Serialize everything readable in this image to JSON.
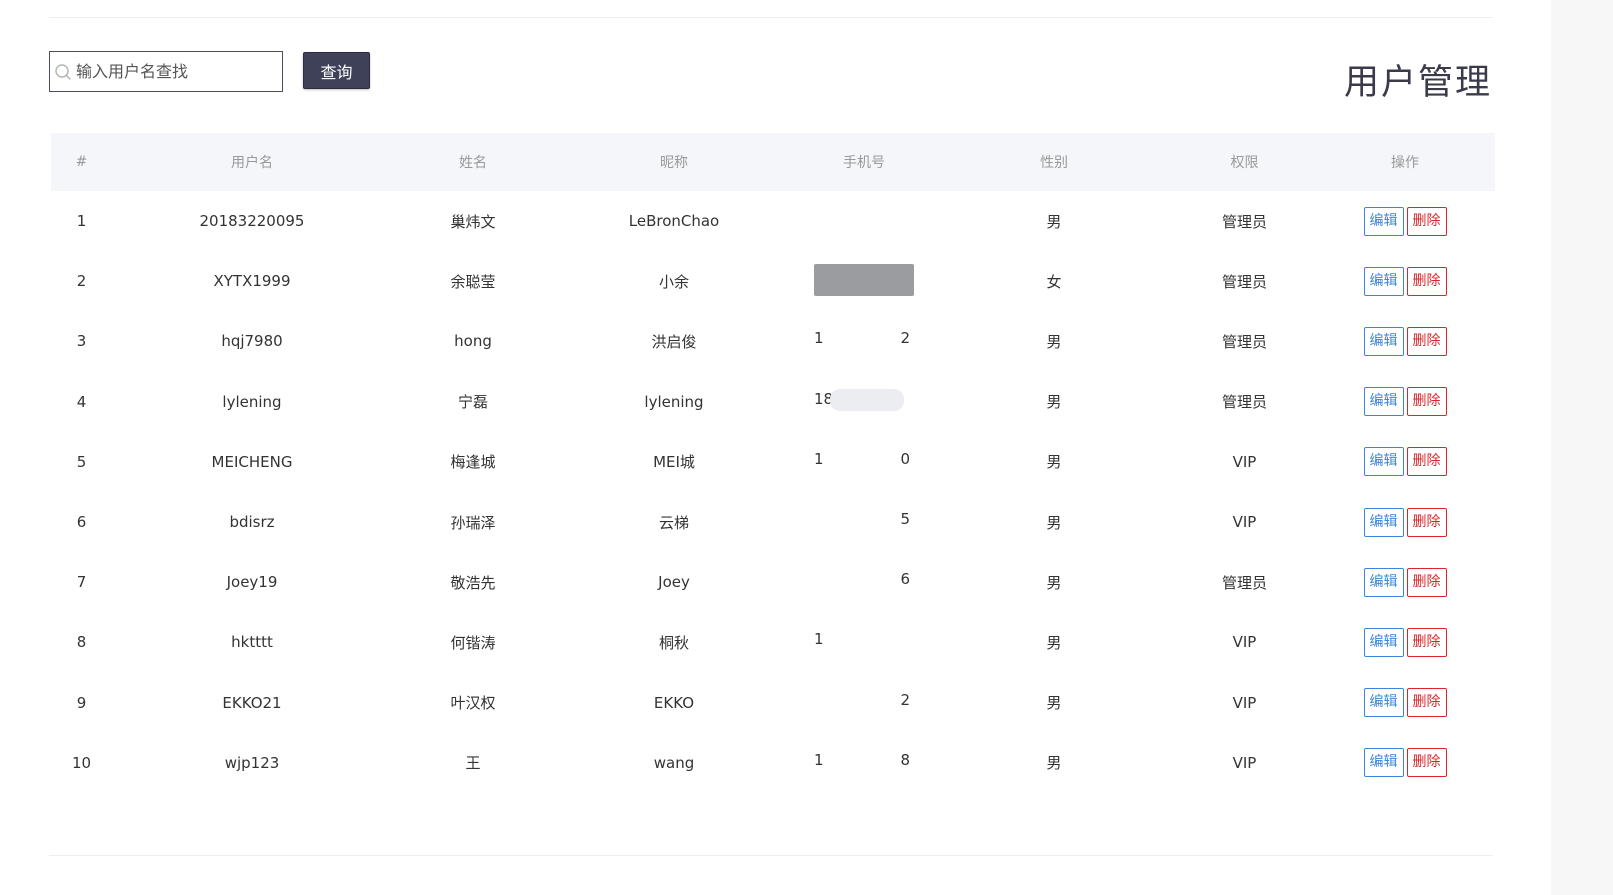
{
  "search": {
    "placeholder": "输入用户名查找",
    "value": ""
  },
  "query_button_label": "查询",
  "page_title": "用户管理",
  "columns": [
    "#",
    "用户名",
    "姓名",
    "昵称",
    "手机号",
    "性别",
    "权限",
    "操作"
  ],
  "actions": {
    "edit": "编辑",
    "delete": "删除"
  },
  "rows": [
    {
      "index": "1",
      "username": "20183220095",
      "name": "巢炜文",
      "nickname": "LeBronChao",
      "phone_prefix": "",
      "phone_suffix": "",
      "gender": "男",
      "role": "管理员"
    },
    {
      "index": "2",
      "username": "XYTX1999",
      "name": "余聪莹",
      "nickname": "小余",
      "phone_prefix": "",
      "phone_suffix": "",
      "gender": "女",
      "role": "管理员"
    },
    {
      "index": "3",
      "username": "hqj7980",
      "name": "hong",
      "nickname": "洪启俊",
      "phone_prefix": "1",
      "phone_suffix": "2",
      "gender": "男",
      "role": "管理员"
    },
    {
      "index": "4",
      "username": "lylening",
      "name": "宁磊",
      "nickname": "lylening",
      "phone_prefix": "18",
      "phone_suffix": "",
      "gender": "男",
      "role": "管理员"
    },
    {
      "index": "5",
      "username": "MEICHENG",
      "name": "梅逢城",
      "nickname": "MEI城",
      "phone_prefix": "1",
      "phone_suffix": "0",
      "gender": "男",
      "role": "VIP"
    },
    {
      "index": "6",
      "username": "bdisrz",
      "name": "孙瑞泽",
      "nickname": "云梯",
      "phone_prefix": "",
      "phone_suffix": "5",
      "gender": "男",
      "role": "VIP"
    },
    {
      "index": "7",
      "username": "Joey19",
      "name": "敬浩先",
      "nickname": "Joey",
      "phone_prefix": "",
      "phone_suffix": "6",
      "gender": "男",
      "role": "管理员"
    },
    {
      "index": "8",
      "username": "hktttt",
      "name": "何锴涛",
      "nickname": "桐秋",
      "phone_prefix": "1",
      "phone_suffix": "",
      "gender": "男",
      "role": "VIP"
    },
    {
      "index": "9",
      "username": "EKKO21",
      "name": "叶汉权",
      "nickname": "EKKO",
      "phone_prefix": "",
      "phone_suffix": "2",
      "gender": "男",
      "role": "VIP"
    },
    {
      "index": "10",
      "username": "wjp123",
      "name": "王",
      "nickname": "wang",
      "phone_prefix": "1",
      "phone_suffix": "8",
      "gender": "男",
      "role": "VIP"
    }
  ],
  "colors": {
    "primary": "#3f4159",
    "edit": "#3b86d9",
    "delete": "#d9262a",
    "header_bg": "#f4f6f9"
  }
}
